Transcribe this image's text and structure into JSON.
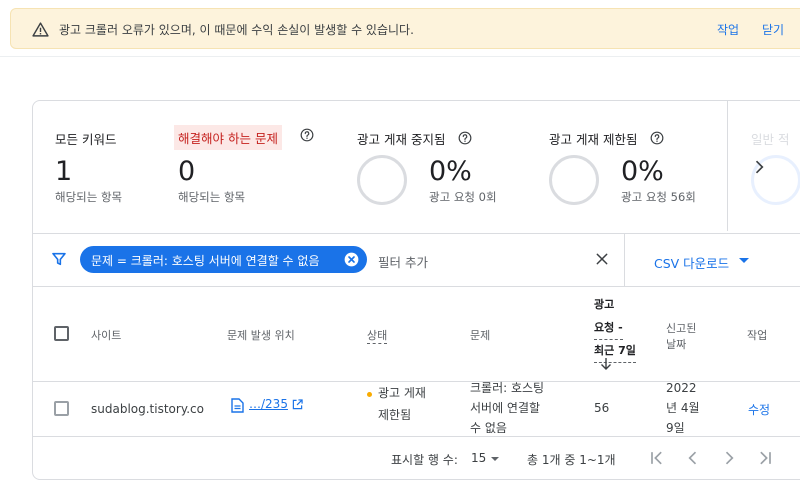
{
  "banner": {
    "message": "광고 크롤러 오류가 있으며, 이 때문에 수익 손실이 발생할 수 있습니다.",
    "action_label": "작업",
    "close_label": "닫기"
  },
  "metrics": [
    {
      "title": "모든 키워드",
      "value": "1",
      "sub": "해당되는 항목"
    },
    {
      "title": "해결해야 하는 문제",
      "value": "0",
      "sub": "해당되는 항목"
    },
    {
      "title": "광고 게재 중지됨",
      "value": "0%",
      "sub": "광고 요청 0회"
    },
    {
      "title": "광고 게재 제한됨",
      "value": "0%",
      "sub": "광고 요청 56회"
    }
  ],
  "metrics_partial_title": "일반 적",
  "filter": {
    "chip_label": "문제 = 크롤러: 호스팅 서버에 연결할 수 없음",
    "add_filter_label": "필터 추가",
    "csv_label": "CSV 다운로드"
  },
  "table": {
    "headers": {
      "site": "사이트",
      "location": "문제 발생 위치",
      "status": "상태",
      "issue": "문제",
      "requests_1": "광고",
      "requests_2": "요청 -",
      "requests_3": "최근 7일",
      "reported_1": "신고된",
      "reported_2": "날짜",
      "action": "작업"
    },
    "row": {
      "site": "sudablog.tistory.co",
      "location": "…/235",
      "status_1": "광고 게재",
      "status_2": "제한됨",
      "issue_1": "크롤러: 호스팅",
      "issue_2": "서버에 연결할",
      "issue_3": "수 없음",
      "requests": "56",
      "date_1": "2022",
      "date_2": "년 4월",
      "date_3": "9일",
      "action": "수정"
    }
  },
  "pagination": {
    "rows_label": "표시할 행 수:",
    "rows_value": "15",
    "range_label": "총 1개 중 1~1개"
  },
  "colors": {
    "accent": "#1a73e8",
    "banner_bg": "#fdf3dc",
    "issue_highlight_bg": "#fce8e6",
    "issue_highlight_text": "#c5221f",
    "status_dot": "#f9ab00"
  }
}
